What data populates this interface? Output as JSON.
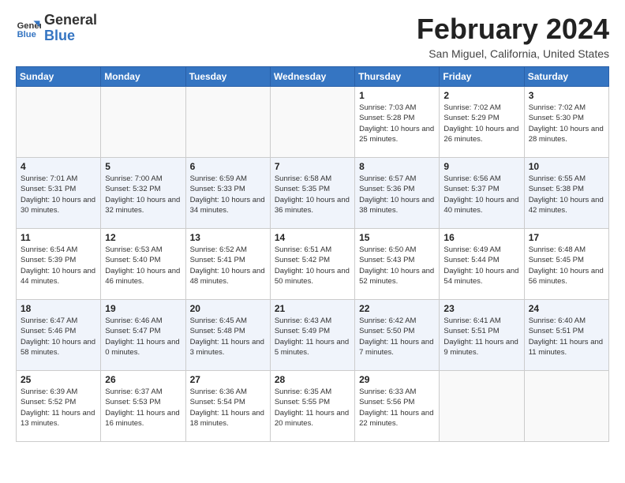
{
  "logo": {
    "line1": "General",
    "line2": "Blue"
  },
  "title": "February 2024",
  "location": "San Miguel, California, United States",
  "days_of_week": [
    "Sunday",
    "Monday",
    "Tuesday",
    "Wednesday",
    "Thursday",
    "Friday",
    "Saturday"
  ],
  "weeks": [
    [
      {
        "day": "",
        "sunrise": "",
        "sunset": "",
        "daylight": ""
      },
      {
        "day": "",
        "sunrise": "",
        "sunset": "",
        "daylight": ""
      },
      {
        "day": "",
        "sunrise": "",
        "sunset": "",
        "daylight": ""
      },
      {
        "day": "",
        "sunrise": "",
        "sunset": "",
        "daylight": ""
      },
      {
        "day": "1",
        "sunrise": "Sunrise: 7:03 AM",
        "sunset": "Sunset: 5:28 PM",
        "daylight": "Daylight: 10 hours and 25 minutes."
      },
      {
        "day": "2",
        "sunrise": "Sunrise: 7:02 AM",
        "sunset": "Sunset: 5:29 PM",
        "daylight": "Daylight: 10 hours and 26 minutes."
      },
      {
        "day": "3",
        "sunrise": "Sunrise: 7:02 AM",
        "sunset": "Sunset: 5:30 PM",
        "daylight": "Daylight: 10 hours and 28 minutes."
      }
    ],
    [
      {
        "day": "4",
        "sunrise": "Sunrise: 7:01 AM",
        "sunset": "Sunset: 5:31 PM",
        "daylight": "Daylight: 10 hours and 30 minutes."
      },
      {
        "day": "5",
        "sunrise": "Sunrise: 7:00 AM",
        "sunset": "Sunset: 5:32 PM",
        "daylight": "Daylight: 10 hours and 32 minutes."
      },
      {
        "day": "6",
        "sunrise": "Sunrise: 6:59 AM",
        "sunset": "Sunset: 5:33 PM",
        "daylight": "Daylight: 10 hours and 34 minutes."
      },
      {
        "day": "7",
        "sunrise": "Sunrise: 6:58 AM",
        "sunset": "Sunset: 5:35 PM",
        "daylight": "Daylight: 10 hours and 36 minutes."
      },
      {
        "day": "8",
        "sunrise": "Sunrise: 6:57 AM",
        "sunset": "Sunset: 5:36 PM",
        "daylight": "Daylight: 10 hours and 38 minutes."
      },
      {
        "day": "9",
        "sunrise": "Sunrise: 6:56 AM",
        "sunset": "Sunset: 5:37 PM",
        "daylight": "Daylight: 10 hours and 40 minutes."
      },
      {
        "day": "10",
        "sunrise": "Sunrise: 6:55 AM",
        "sunset": "Sunset: 5:38 PM",
        "daylight": "Daylight: 10 hours and 42 minutes."
      }
    ],
    [
      {
        "day": "11",
        "sunrise": "Sunrise: 6:54 AM",
        "sunset": "Sunset: 5:39 PM",
        "daylight": "Daylight: 10 hours and 44 minutes."
      },
      {
        "day": "12",
        "sunrise": "Sunrise: 6:53 AM",
        "sunset": "Sunset: 5:40 PM",
        "daylight": "Daylight: 10 hours and 46 minutes."
      },
      {
        "day": "13",
        "sunrise": "Sunrise: 6:52 AM",
        "sunset": "Sunset: 5:41 PM",
        "daylight": "Daylight: 10 hours and 48 minutes."
      },
      {
        "day": "14",
        "sunrise": "Sunrise: 6:51 AM",
        "sunset": "Sunset: 5:42 PM",
        "daylight": "Daylight: 10 hours and 50 minutes."
      },
      {
        "day": "15",
        "sunrise": "Sunrise: 6:50 AM",
        "sunset": "Sunset: 5:43 PM",
        "daylight": "Daylight: 10 hours and 52 minutes."
      },
      {
        "day": "16",
        "sunrise": "Sunrise: 6:49 AM",
        "sunset": "Sunset: 5:44 PM",
        "daylight": "Daylight: 10 hours and 54 minutes."
      },
      {
        "day": "17",
        "sunrise": "Sunrise: 6:48 AM",
        "sunset": "Sunset: 5:45 PM",
        "daylight": "Daylight: 10 hours and 56 minutes."
      }
    ],
    [
      {
        "day": "18",
        "sunrise": "Sunrise: 6:47 AM",
        "sunset": "Sunset: 5:46 PM",
        "daylight": "Daylight: 10 hours and 58 minutes."
      },
      {
        "day": "19",
        "sunrise": "Sunrise: 6:46 AM",
        "sunset": "Sunset: 5:47 PM",
        "daylight": "Daylight: 11 hours and 0 minutes."
      },
      {
        "day": "20",
        "sunrise": "Sunrise: 6:45 AM",
        "sunset": "Sunset: 5:48 PM",
        "daylight": "Daylight: 11 hours and 3 minutes."
      },
      {
        "day": "21",
        "sunrise": "Sunrise: 6:43 AM",
        "sunset": "Sunset: 5:49 PM",
        "daylight": "Daylight: 11 hours and 5 minutes."
      },
      {
        "day": "22",
        "sunrise": "Sunrise: 6:42 AM",
        "sunset": "Sunset: 5:50 PM",
        "daylight": "Daylight: 11 hours and 7 minutes."
      },
      {
        "day": "23",
        "sunrise": "Sunrise: 6:41 AM",
        "sunset": "Sunset: 5:51 PM",
        "daylight": "Daylight: 11 hours and 9 minutes."
      },
      {
        "day": "24",
        "sunrise": "Sunrise: 6:40 AM",
        "sunset": "Sunset: 5:51 PM",
        "daylight": "Daylight: 11 hours and 11 minutes."
      }
    ],
    [
      {
        "day": "25",
        "sunrise": "Sunrise: 6:39 AM",
        "sunset": "Sunset: 5:52 PM",
        "daylight": "Daylight: 11 hours and 13 minutes."
      },
      {
        "day": "26",
        "sunrise": "Sunrise: 6:37 AM",
        "sunset": "Sunset: 5:53 PM",
        "daylight": "Daylight: 11 hours and 16 minutes."
      },
      {
        "day": "27",
        "sunrise": "Sunrise: 6:36 AM",
        "sunset": "Sunset: 5:54 PM",
        "daylight": "Daylight: 11 hours and 18 minutes."
      },
      {
        "day": "28",
        "sunrise": "Sunrise: 6:35 AM",
        "sunset": "Sunset: 5:55 PM",
        "daylight": "Daylight: 11 hours and 20 minutes."
      },
      {
        "day": "29",
        "sunrise": "Sunrise: 6:33 AM",
        "sunset": "Sunset: 5:56 PM",
        "daylight": "Daylight: 11 hours and 22 minutes."
      },
      {
        "day": "",
        "sunrise": "",
        "sunset": "",
        "daylight": ""
      },
      {
        "day": "",
        "sunrise": "",
        "sunset": "",
        "daylight": ""
      }
    ]
  ]
}
